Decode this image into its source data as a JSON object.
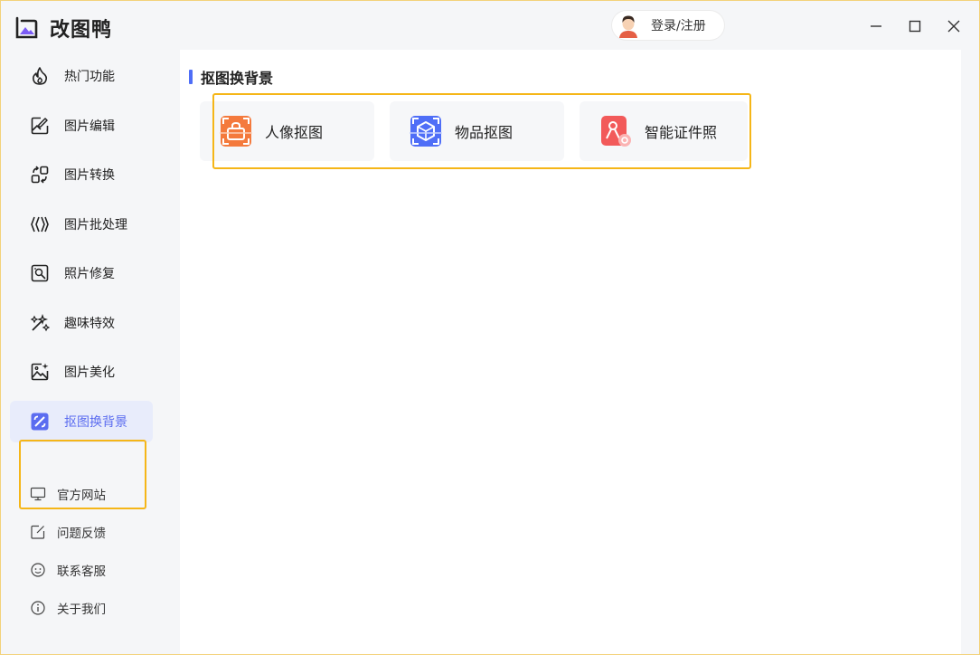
{
  "app": {
    "title": "改图鸭"
  },
  "header": {
    "login_label": "登录/注册"
  },
  "sidebar": {
    "items": [
      {
        "label": "热门功能",
        "icon": "flame-icon"
      },
      {
        "label": "图片编辑",
        "icon": "image-edit-icon"
      },
      {
        "label": "图片转换",
        "icon": "convert-icon"
      },
      {
        "label": "图片批处理",
        "icon": "batch-icon"
      },
      {
        "label": "照片修复",
        "icon": "photo-repair-icon"
      },
      {
        "label": "趣味特效",
        "icon": "magic-wand-icon"
      },
      {
        "label": "图片美化",
        "icon": "image-beautify-icon"
      },
      {
        "label": "抠图换背景",
        "icon": "cutout-icon"
      }
    ],
    "active_index": 7,
    "sub_items": [
      {
        "label": "官方网站",
        "icon": "monitor-icon"
      },
      {
        "label": "问题反馈",
        "icon": "feedback-icon"
      },
      {
        "label": "联系客服",
        "icon": "customer-service-icon"
      },
      {
        "label": "关于我们",
        "icon": "info-icon"
      }
    ]
  },
  "main": {
    "section_title": "抠图换背景",
    "cards": [
      {
        "label": "人像抠图",
        "icon": "portrait-cutout-icon",
        "color": "#f47a3d"
      },
      {
        "label": "物品抠图",
        "icon": "object-cutout-icon",
        "color": "#4f6ef7"
      },
      {
        "label": "智能证件照",
        "icon": "id-photo-icon",
        "color": "#f25a5a"
      }
    ]
  },
  "colors": {
    "accent": "#5b6cf0",
    "highlight": "#f5b618",
    "active_bg": "#e8ecfb"
  }
}
